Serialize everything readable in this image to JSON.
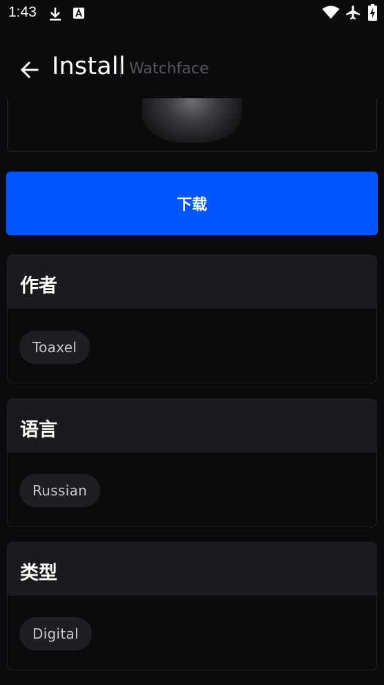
{
  "status_bar": {
    "time": "1:43",
    "icons": [
      "download-icon",
      "font-icon",
      "wifi-icon",
      "airplane-icon",
      "battery-charging-icon"
    ]
  },
  "header": {
    "title": "Install",
    "separator": "|",
    "subtitle": "Watchface"
  },
  "download_button": {
    "label": "下载"
  },
  "sections": [
    {
      "title": "作者",
      "chip": "Toaxel"
    },
    {
      "title": "语言",
      "chip": "Russian"
    },
    {
      "title": "类型",
      "chip": "Digital"
    }
  ],
  "colors": {
    "background": "#0b0b0d",
    "accent": "#0057ff",
    "card_header": "#1b1b1f",
    "chip_bg": "#1f1f23"
  }
}
